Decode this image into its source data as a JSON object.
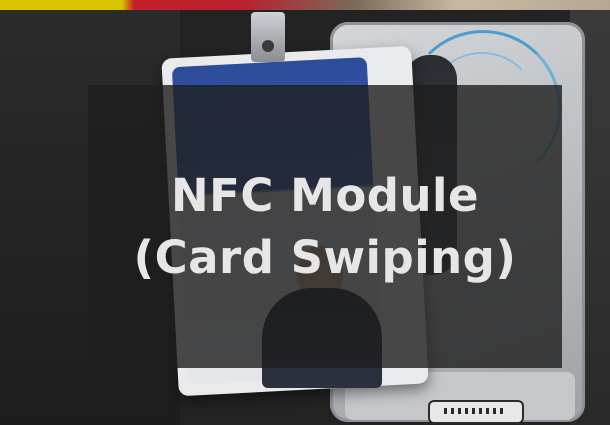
{
  "caption": {
    "line1": "NFC Module",
    "line2": "(Card Swiping)"
  }
}
